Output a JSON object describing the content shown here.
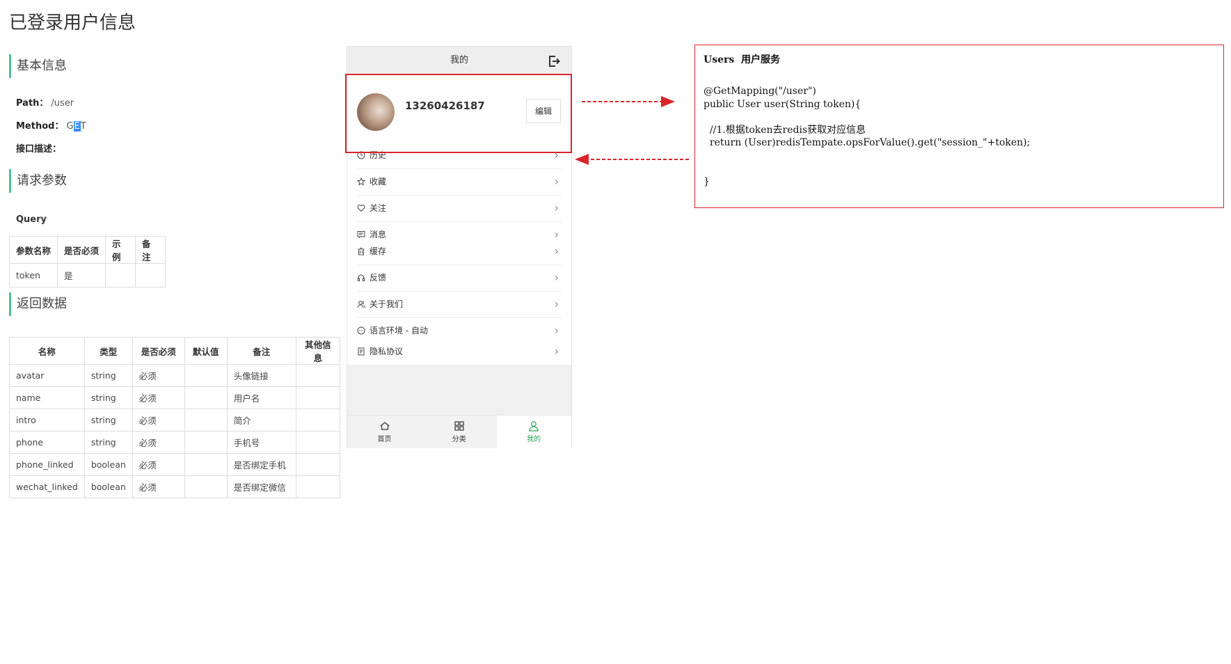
{
  "page_title": "已登录用户信息",
  "basic": {
    "heading": "基本信息",
    "path_label": "Path：",
    "path_value": "/user",
    "method_label": "Method：",
    "method_value_pre": "G",
    "method_value_sel": "E",
    "method_value_post": "T",
    "desc_label": "接口描述："
  },
  "request": {
    "heading": "请求参数",
    "query_label": "Query",
    "headers": [
      "参数名称",
      "是否必须",
      "示例",
      "备注"
    ],
    "rows": [
      [
        "token",
        "是",
        "",
        ""
      ]
    ]
  },
  "response": {
    "heading": "返回数据",
    "headers": [
      "名称",
      "类型",
      "是否必须",
      "默认值",
      "备注",
      "其他信息"
    ],
    "rows": [
      [
        "avatar",
        "string",
        "必须",
        "",
        "头像链接",
        ""
      ],
      [
        "name",
        "string",
        "必须",
        "",
        "用户名",
        ""
      ],
      [
        "intro",
        "string",
        "必须",
        "",
        "简介",
        ""
      ],
      [
        "phone",
        "string",
        "必须",
        "",
        "手机号",
        ""
      ],
      [
        "phone_linked",
        "boolean",
        "必须",
        "",
        "是否绑定手机",
        ""
      ],
      [
        "wechat_linked",
        "boolean",
        "必须",
        "",
        "是否绑定微信",
        ""
      ]
    ]
  },
  "phone": {
    "title": "我的",
    "exit_icon": "logout-icon",
    "user_phone": "13260426187",
    "edit_label": "编辑",
    "menu_groups": [
      [
        {
          "label": "历史",
          "icon": "clock-icon"
        },
        {
          "label": "收藏",
          "icon": "star-icon"
        },
        {
          "label": "关注",
          "icon": "heart-icon"
        },
        {
          "label": "消息",
          "icon": "message-icon"
        }
      ],
      [
        {
          "label": "缓存",
          "icon": "trash-icon"
        },
        {
          "label": "反馈",
          "icon": "headset-icon"
        },
        {
          "label": "关于我们",
          "icon": "people-icon"
        },
        {
          "label": "语言环境 - 自动",
          "icon": "chat-icon"
        }
      ],
      [
        {
          "label": "隐私协议",
          "icon": "document-icon"
        }
      ]
    ],
    "tabs": [
      {
        "label": "首页",
        "icon": "home-icon",
        "active": false
      },
      {
        "label": "分类",
        "icon": "grid-icon",
        "active": false
      },
      {
        "label": "我的",
        "icon": "user-icon",
        "active": true
      }
    ],
    "active_color": "#2aa24f"
  },
  "code": {
    "service_title": "Users  用户服务",
    "lines": [
      "@GetMapping(\"/user\")",
      "public User user(String token){",
      "",
      "  //1.根据token去redis获取对应信息",
      "  return (User)redisTempate.opsForValue().get(\"session_\"+token);",
      "",
      "",
      "}"
    ]
  },
  "annotation_color": "#d9252b",
  "accent_color": "#4fc08d"
}
